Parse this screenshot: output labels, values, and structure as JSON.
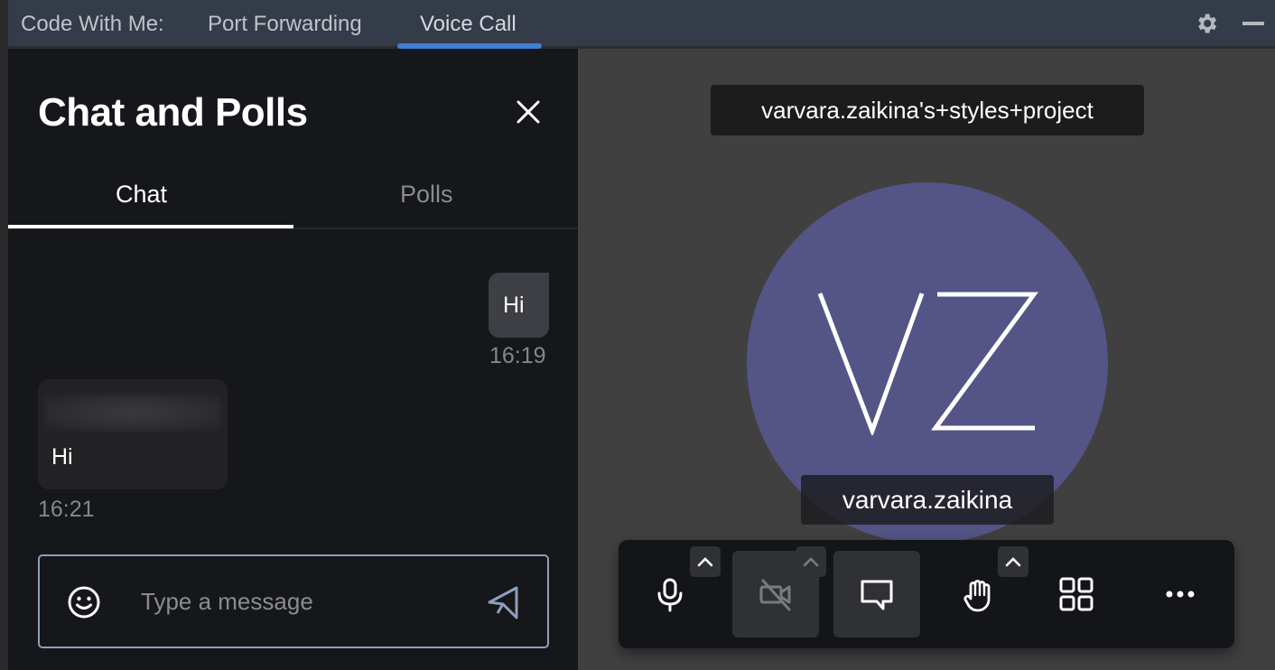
{
  "header": {
    "title": "Code With Me:",
    "tabs": [
      {
        "label": "Port Forwarding",
        "active": false
      },
      {
        "label": "Voice Call",
        "active": true
      }
    ],
    "icons": [
      "gear-icon",
      "minimize-icon"
    ],
    "accent_color": "#3f7ed6"
  },
  "chat_panel": {
    "title": "Chat and Polls",
    "close_icon": "close-icon",
    "tabs": [
      {
        "label": "Chat",
        "active": true
      },
      {
        "label": "Polls",
        "active": false
      }
    ],
    "messages": [
      {
        "direction": "outgoing",
        "text": "Hi",
        "time": "16:19"
      },
      {
        "direction": "incoming",
        "sender": "(blurred)",
        "text": "Hi",
        "time": "16:21"
      }
    ],
    "composer": {
      "placeholder": "Type a message",
      "value": "",
      "emoji_icon": "smiley-icon",
      "send_icon": "send-icon",
      "border_color": "#8da0bb"
    }
  },
  "call": {
    "room_name": "varvara.zaikina's+styles+project",
    "participant": {
      "initials": "VZ",
      "name": "varvara.zaikina",
      "avatar_color": "#545487"
    },
    "toolbar": [
      {
        "name": "microphone",
        "icon": "microphone-icon",
        "has_menu": true,
        "state": "on"
      },
      {
        "name": "camera",
        "icon": "camera-off-icon",
        "has_menu": true,
        "state": "off"
      },
      {
        "name": "chat",
        "icon": "chat-bubble-icon",
        "has_menu": false,
        "state": "active"
      },
      {
        "name": "raise-hand",
        "icon": "hand-icon",
        "has_menu": true,
        "state": "idle"
      },
      {
        "name": "tile-view",
        "icon": "grid-icon",
        "has_menu": false,
        "state": "idle"
      },
      {
        "name": "more",
        "icon": "more-icon",
        "has_menu": false,
        "state": "idle"
      }
    ]
  }
}
